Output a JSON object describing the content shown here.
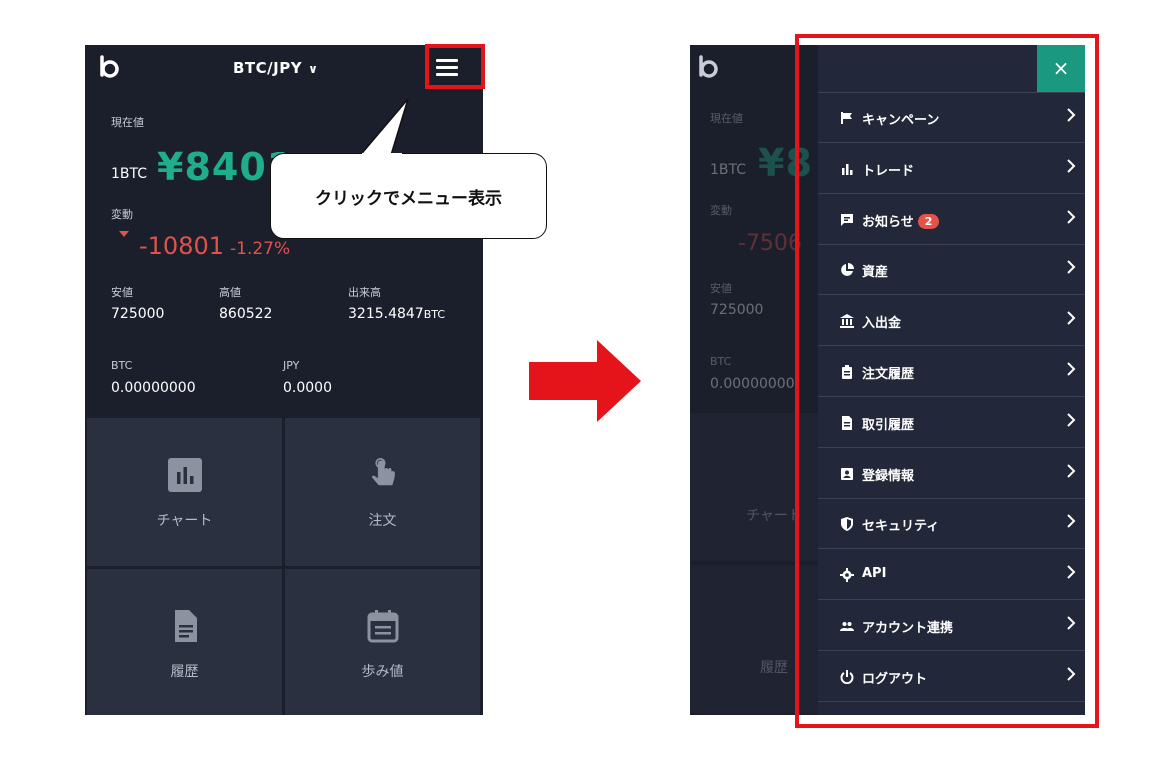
{
  "left_screen": {
    "pair_label": "BTC/JPY",
    "current_price_label": "現在値",
    "unit_label": "1BTC",
    "price_value": "¥8401",
    "change_label": "変動",
    "change_value": "-10801",
    "change_percent": "-1.27%",
    "low_label": "安値",
    "low_value": "725000",
    "high_label": "高値",
    "high_value": "860522",
    "volume_label": "出来高",
    "volume_value": "3215.4847",
    "volume_unit": "BTC",
    "btc_label": "BTC",
    "btc_value": "0.00000000",
    "jpy_label": "JPY",
    "jpy_value": "0.0000",
    "tiles": [
      "チャート",
      "注文",
      "履歴",
      "歩み値"
    ]
  },
  "callout": {
    "text": "クリックでメニュー表示"
  },
  "right_screen": {
    "bg_current_price_label": "現在値",
    "bg_unit_label": "1BTC",
    "bg_price_fragment": "¥8",
    "bg_change_label": "変動",
    "bg_change_value": "-7506",
    "bg_low_label": "安値",
    "bg_low_value": "725000",
    "bg_btc_label": "BTC",
    "bg_btc_value": "0.00000000",
    "bg_tile_chart": "チャート",
    "bg_tile_history": "履歴",
    "close_symbol": "×",
    "menu": [
      {
        "label": "キャンペーン",
        "icon": "flag-icon"
      },
      {
        "label": "トレード",
        "icon": "bar-chart-icon"
      },
      {
        "label": "お知らせ",
        "icon": "message-icon",
        "badge": "2"
      },
      {
        "label": "資産",
        "icon": "pie-chart-icon"
      },
      {
        "label": "入出金",
        "icon": "bank-icon"
      },
      {
        "label": "注文履歴",
        "icon": "clipboard-icon"
      },
      {
        "label": "取引履歴",
        "icon": "document-icon"
      },
      {
        "label": "登録情報",
        "icon": "id-card-icon"
      },
      {
        "label": "セキュリティ",
        "icon": "shield-icon"
      },
      {
        "label": "API",
        "icon": "gear-icon"
      },
      {
        "label": "アカウント連携",
        "icon": "people-icon"
      },
      {
        "label": "ログアウト",
        "icon": "power-icon"
      }
    ]
  },
  "colors": {
    "bg": "#1b1f2b",
    "accent": "#1fae8c",
    "negative": "#e0524a",
    "highlight": "#e5141b",
    "drawer": "#222839"
  }
}
